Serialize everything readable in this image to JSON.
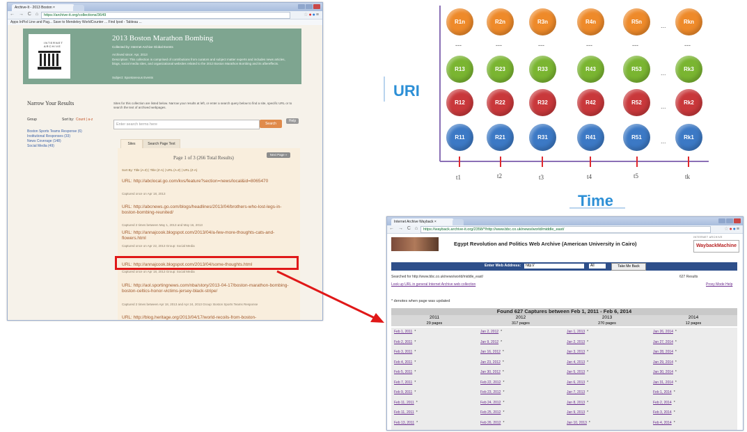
{
  "left_browser": {
    "tab_label": "Archive-It - 2013 Boston ×",
    "url": "https://archive-it.org/collections/3649",
    "bookmarks": "Apps   InPixl Line and Pag...   Save to Mendeley   WorldCounter   ...   Find Ipod - Tableau ...",
    "page": {
      "logo_text": "INTERNET ARCHIVE",
      "collection_title": "2013 Boston Marathon Bombing",
      "collected_by": "Collected by: Internet Archive Global Events",
      "archived_since": "Archived since: Apr, 2013",
      "description": "Description: This collection is comprised of contributions from curators and subject matter experts and includes news articles, blogs, social media sites, and organizational websites related to the 2013 Boston Marathon Bombing and its aftereffects.",
      "subject": "Subject: Spontaneous Events",
      "narrow_heading": "Narrow Your Results",
      "group_label": "Group",
      "sort_label": "Sort by:",
      "sort_options": "Count | a-z",
      "groups": [
        "Boston Sports Teams Response (6)",
        "Institutional Responses (33)",
        "News Coverage (148)",
        "Social Media (49)"
      ],
      "instructions": "Sites for this collection are listed below. Narrow your results at left, or enter a search query below to find a site, specific URL or to search the text of archived webpages.",
      "search_placeholder": "Enter search terms here",
      "search_button": "Search",
      "help_button": "Help",
      "tab_sites": "Sites",
      "tab_search_text": "Search Page Text",
      "page_info": "Page 1 of 3 (266 Total Results)",
      "next_page": "Next Page »",
      "sort_bar": "Sort By: Title (A-Z) | Title (Z-A) | URL (A-Z) | URL (Z-A)",
      "results": [
        {
          "title": "URL: http://abclocal.go.com/kvs/feature?section=news/local&id=8065470",
          "meta": "Captured once on Apr 18, 2013"
        },
        {
          "title": "URL: http://abcnews.go.com/blogs/headlines/2013/04/brothers-who-lost-legs-in-boston-bombing-reunited/",
          "meta": "Captured 2 times between May 1, 2013 and May 16, 2013"
        },
        {
          "title": "URL: http://annajcook.blogspot.com/2013/04/a-few-more-thoughts-cats-and-flowers.html",
          "meta": "Captured once on Apr 22, 2013   Group: Social Media"
        },
        {
          "title": "URL: http://annajcook.blogspot.com/2013/04/some-thoughts.html",
          "meta": "Captured once on Apr 18, 2013   Group: Social Media"
        },
        {
          "title": "URL: http://aol.sportingnews.com/nba/story/2013-04-17/boston-marathon-bombing-boston-celtics-honor-victims-jersey-black-stripe/",
          "meta": "Captured 2 times between Apr 18, 2013 and Apr 24, 2013   Group: Boston Sports Teams Response"
        },
        {
          "title": "URL: http://blog.heritage.org/2013/04/17/world-recoils-from-boston-",
          "meta": ""
        }
      ]
    }
  },
  "diagram": {
    "y_axis_label": "URI",
    "x_axis_label": "Time",
    "ellipsis": "...",
    "vdots": "---",
    "rows": [
      {
        "color": "orange",
        "labels": [
          "R1n",
          "R2n",
          "R3n",
          "R4n",
          "R5n",
          "Rkn"
        ]
      },
      {
        "color": "green",
        "labels": [
          "R13",
          "R23",
          "R33",
          "R43",
          "R53",
          "Rk3"
        ]
      },
      {
        "color": "red",
        "labels": [
          "R12",
          "R22",
          "R32",
          "R42",
          "R52",
          "Rk2"
        ]
      },
      {
        "color": "blue",
        "labels": [
          "R11",
          "R21",
          "R31",
          "R41",
          "R51",
          "Rk1"
        ]
      }
    ],
    "time_ticks": [
      "t1",
      "t2",
      "t3",
      "t4",
      "t5",
      "tk"
    ]
  },
  "right_browser": {
    "tab_label": "Internet Archive Wayback ×",
    "url": "https://wayback.archive-it.org/2358/*/http://www.bbc.co.uk/news/world/middle_east/",
    "collection_title": "Egypt Revolution and Politics Web Archive (American University in Cairo)",
    "wayback_logo": "WaybackMachine",
    "wayback_logo_small": "INTERNET ARCHIVE",
    "enter_label": "Enter Web Address:",
    "address_value": "http://",
    "all_option": "All",
    "take_me_back": "Take Me Back",
    "searched_for": "Searched for http://www.bbc.co.uk/news/world/middle_east/",
    "results_count": "627 Results",
    "look_up": "Look up URL in general Internet Archive web collection",
    "proxy": "Proxy Mode Help",
    "updated_note": "* denotes when page was updated",
    "found_header": "Found 627 Captures between Feb 1, 2011 - Feb 6, 2014",
    "years": [
      {
        "year": "2011",
        "pages": "29 pages"
      },
      {
        "year": "2012",
        "pages": "317 pages"
      },
      {
        "year": "2013",
        "pages": "270 pages"
      },
      {
        "year": "2014",
        "pages": "12 pages"
      }
    ],
    "dates": [
      [
        "Feb 1, 2011",
        "Feb 2, 2011",
        "Feb 3, 2011",
        "Feb 4, 2011",
        "Feb 5, 2011",
        "Feb 7, 2011",
        "Feb 9, 2011",
        "Feb 11, 2011",
        "Feb 11, 2011",
        "Feb 13, 2011"
      ],
      [
        "Jan 2, 2012",
        "Jan 9, 2012",
        "Jan 16, 2012",
        "Jan 23, 2012",
        "Jan 30, 2012",
        "Feb 22, 2012",
        "Feb 23, 2012",
        "Feb 24, 2012",
        "Feb 25, 2012",
        "Feb 26, 2012"
      ],
      [
        "Jan 1, 2013",
        "Jan 2, 2013",
        "Jan 3, 2013",
        "Jan 4, 2013",
        "Jan 5, 2013",
        "Jan 6, 2013",
        "Jan 7, 2013",
        "Jan 8, 2013",
        "Jan 9, 2013",
        "Jan 10, 2013"
      ],
      [
        "Jan 26, 2014",
        "Jan 27, 2014",
        "Jan 28, 2014",
        "Jan 29, 2014",
        "Jan 30, 2014",
        "Jan 31, 2014",
        "Feb 1, 2014",
        "Feb 2, 2014",
        "Feb 3, 2014",
        "Feb 4, 2014"
      ]
    ],
    "star": "*"
  },
  "colors": {
    "arrow": "#e01818",
    "highlight_box": "#e01818",
    "axis": "#8a6fb5",
    "tick": "#e0282d"
  }
}
